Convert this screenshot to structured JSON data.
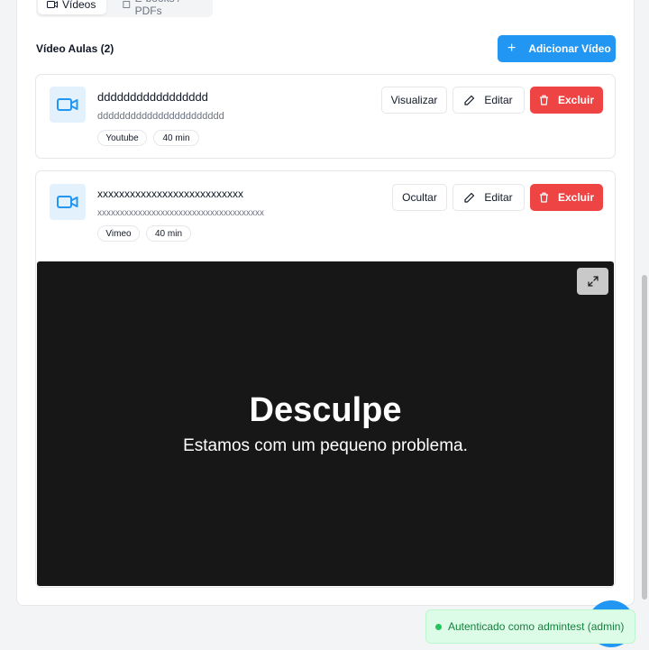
{
  "tabs": [
    {
      "label": "Vídeos"
    },
    {
      "label": "E-books / PDFs"
    }
  ],
  "section": {
    "title": "Vídeo Aulas (2)",
    "add_button_label": "Adicionar Vídeo"
  },
  "videos": [
    {
      "title": "ddddddddddddddddd",
      "description": "ddddddddddddddddddddddd",
      "platform": "Youtube",
      "duration": "40 min",
      "toggle_label": "Visualizar",
      "edit_label": "Editar",
      "delete_label": "Excluir"
    },
    {
      "title": "xxxxxxxxxxxxxxxxxxxxxxxxxxx",
      "description": "xxxxxxxxxxxxxxxxxxxxxxxxxxxxxxxxxxxxx",
      "platform": "Vimeo",
      "duration": "40 min",
      "toggle_label": "Ocultar",
      "edit_label": "Editar",
      "delete_label": "Excluir"
    }
  ],
  "player": {
    "error_title": "Desculpe",
    "error_message": "Estamos com um pequeno problema."
  },
  "toast": {
    "message": "Autenticado como admintest (admin)"
  },
  "icons": [
    "video-icon",
    "tab-video-icon",
    "tab-book-icon",
    "plus-icon",
    "edit-icon",
    "trash-icon",
    "fullscreen-icon"
  ],
  "colors": {
    "primary": "#2196f3",
    "danger": "#ef4444",
    "success": "#22c55e"
  }
}
